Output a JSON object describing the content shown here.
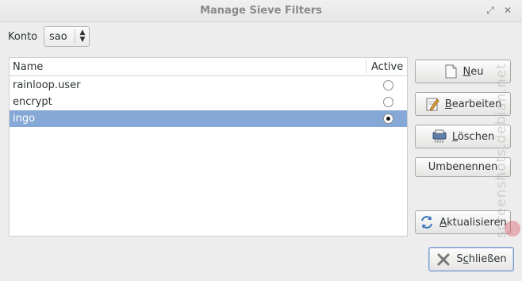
{
  "window": {
    "title": "Manage Sieve Filters"
  },
  "account": {
    "label": "Konto",
    "selected": "sao"
  },
  "filter_list": {
    "columns": {
      "name": "Name",
      "active": "Active"
    },
    "rows": [
      {
        "name": "rainloop.user",
        "active": false,
        "selected": false
      },
      {
        "name": "encrypt",
        "active": false,
        "selected": false
      },
      {
        "name": "ingo",
        "active": true,
        "selected": true
      }
    ]
  },
  "buttons": {
    "new": {
      "pre": "",
      "key": "N",
      "post": "eu"
    },
    "edit": {
      "pre": "",
      "key": "B",
      "post": "earbeiten"
    },
    "delete": {
      "pre": "",
      "key": "L",
      "post": "öschen"
    },
    "rename": {
      "label": "Umbenennen"
    },
    "refresh": {
      "pre": "",
      "key": "A",
      "post": "ktualisieren"
    },
    "close": {
      "pre": "S",
      "key": "c",
      "post": "hließen"
    }
  },
  "watermark": "screenshots.debian.net",
  "colors": {
    "selection": "#86a8d6",
    "window_bg": "#ededed"
  }
}
